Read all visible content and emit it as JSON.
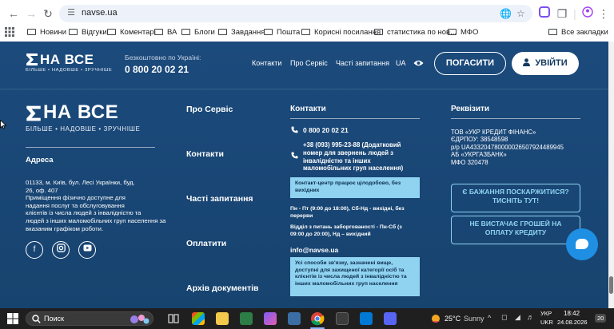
{
  "browser": {
    "url": "navse.ua",
    "bookmarks": [
      "Новини",
      "Відгуки",
      "Коментарі",
      "ВА",
      "Блоги",
      "Завдання",
      "Пошта",
      "Корисні посилання",
      "статистика по нов...",
      "МФО"
    ],
    "all_bookmarks": "Все закладки"
  },
  "header": {
    "logo": "НА ВСЕ",
    "logo_sub": "БІЛЬШЕ • НАДОВШЕ • ЗРУЧНІШЕ",
    "free_label": "Безкоштовно по Україні:",
    "phone": "0 800 20 02 21",
    "nav": [
      "Контакти",
      "Про Сервіс",
      "Часті запитання"
    ],
    "lang": "UA",
    "repay_label": "ПОГАСИТИ",
    "login_label": "УВІЙТИ"
  },
  "footer": {
    "address_title": "Адреса",
    "address_lines": [
      "01133, м. Київ, бул. Лесі Українки, буд.",
      "26, оф. 407",
      "Приміщення фізично доступне для",
      "надання послуг та обслуговування",
      "клієнтів із числа людей з інвалідністю та",
      "людей з інших маломобільних груп населення за",
      "вказаним графіком роботи."
    ],
    "links": [
      "Про Сервіс",
      "Контакти",
      "Часті запитання",
      "Оплатити",
      "Архів документів"
    ],
    "contacts_title": "Контакти",
    "phone1": "0 800 20 02 21",
    "phone2_lines": [
      "+38 (093) 995-23-88 (Додатковий",
      "номер для звернень людей з",
      "інвалідністю та інших",
      "маломобільних груп населення)"
    ],
    "note1_lines": [
      "Контакт-центр працює цілодобово, без",
      "вихідних"
    ],
    "schedule1_lines": [
      "Пн - Пт (9:00 до 18:00), Сб-Нд - вихідні, без",
      "перерви"
    ],
    "schedule2_lines": [
      "Відділ з питань заборгованості - Пн-Сб (з",
      "09:00 до 20:00), Нд – вихідний"
    ],
    "email": "info@navse.ua",
    "note2_lines": [
      "Усі способи зв'язку, зазначені вище,",
      "доступні для захищеної категорії осіб та",
      "клієнтів із числа людей з інвалідністю та",
      "інших маломобільних груп населення"
    ],
    "requisites_title": "Реквізити",
    "requisites_lines": [
      "ТОВ «УКР КРЕДИТ ФІНАНС»",
      "ЄДРПОУ: 38548598",
      "р/р UA433204780000026507924489945",
      "АБ «УКРГАЗБАНК»",
      "МФО 320478"
    ],
    "cta1_lines": [
      "Є БАЖАННЯ ПОСКАРЖИТИСЯ?",
      "ТИСНІТЬ ТУТ!"
    ],
    "cta2_lines": [
      "НЕ ВИСТАЧАЄ ГРОШЕЙ НА",
      "ОПЛАТУ КРЕДИТУ"
    ]
  },
  "taskbar": {
    "search_label": "Поиск",
    "temperature": "25°C",
    "weather": "Sunny",
    "lang_top": "УКР",
    "lang_bottom": "UKR",
    "time": "18:42",
    "date": "24.08.2026",
    "notif_count": "20"
  },
  "colors": {
    "site_bg": "#1b4a7c",
    "accent_light": "#8fd3f0",
    "chat": "#1f8fe3"
  }
}
